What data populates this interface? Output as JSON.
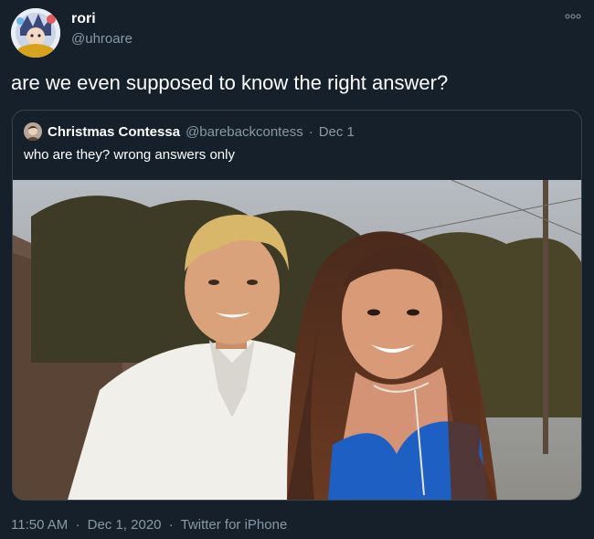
{
  "author": {
    "name": "rori",
    "handle": "@uhroare"
  },
  "more_icon": "more-dots-icon",
  "tweet": {
    "text": "are we even supposed to know the right answer?"
  },
  "quoted": {
    "name": "Christmas Contessa",
    "handle": "@barebackcontess",
    "separator": "·",
    "date": "Dec 1",
    "text": "who are they? wrong answers only"
  },
  "meta": {
    "time": "11:50 AM",
    "sep1": "·",
    "date": "Dec 1, 2020",
    "sep2": "·",
    "client": "Twitter for iPhone"
  },
  "colors": {
    "background": "#15202b",
    "muted": "#8899a6",
    "border": "#38444d"
  }
}
